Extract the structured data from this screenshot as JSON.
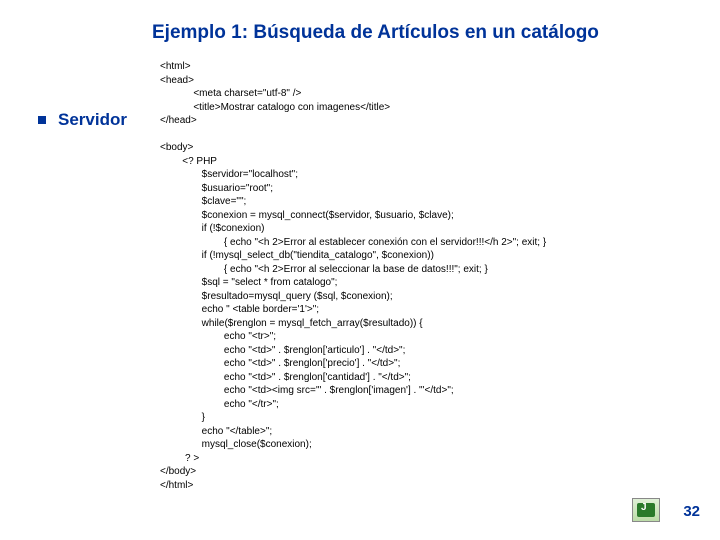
{
  "title": "Ejemplo 1: Búsqueda de Artículos en un catálogo",
  "bullet_label": "Servidor",
  "code": "<html>\n<head>\n            <meta charset=\"utf-8\" />\n            <title>Mostrar catalogo con imagenes</title>\n</head>\n\n<body>\n        <? PHP\n               $servidor=\"localhost\";\n               $usuario=\"root\";\n               $clave=\"\";\n               $conexion = mysql_connect($servidor, $usuario, $clave);\n               if (!$conexion)\n                       { echo \"<h 2>Error al establecer conexión con el servidor!!!</h 2>\"; exit; }\n               if (!mysql_select_db(\"tiendita_catalogo\", $conexion))\n                       { echo \"<h 2>Error al seleccionar la base de datos!!!\"; exit; }\n               $sql = \"select * from catalogo\";\n               $resultado=mysql_query ($sql, $conexion);\n               echo \" <table border='1'>\";\n               while($renglon = mysql_fetch_array($resultado)) {\n                       echo \"<tr>\";\n                       echo \"<td>\" . $renglon['articulo'] . \"</td>\";\n                       echo \"<td>\" . $renglon['precio'] . \"</td>\";\n                       echo \"<td>\" . $renglon['cantidad'] . \"</td>\";\n                       echo \"<td><img src='\" . $renglon['imagen'] . \"'</td>\";\n                       echo \"</tr>\";\n               }\n               echo \"</table>\";\n               mysql_close($conexion);\n         ? >\n</body>\n</html>",
  "page_number": "32"
}
